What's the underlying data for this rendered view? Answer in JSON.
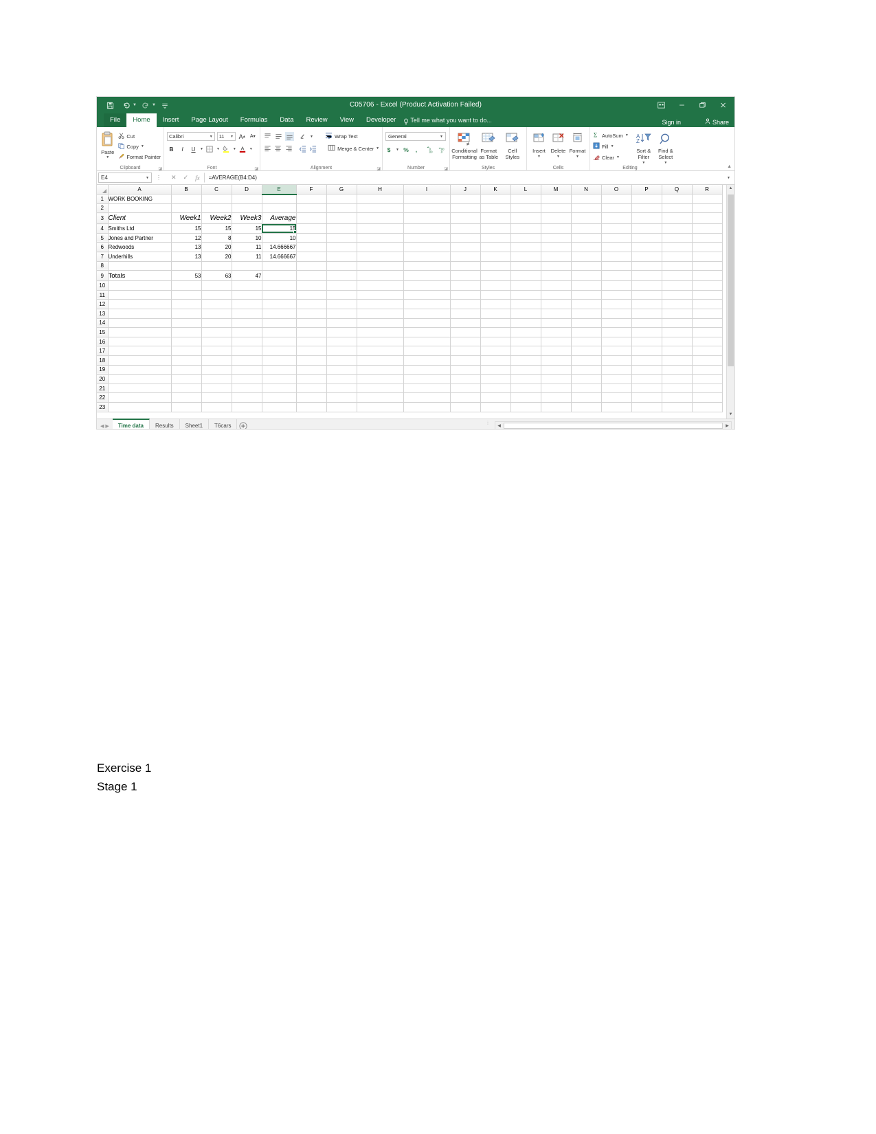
{
  "window": {
    "title": "C05706 - Excel (Product Activation Failed)",
    "quick_access": [
      {
        "name": "save-icon",
        "label": "Save"
      },
      {
        "name": "undo-icon",
        "label": "Undo"
      },
      {
        "name": "redo-icon",
        "label": "Redo"
      },
      {
        "name": "customize-qat-icon",
        "label": "Customize Quick Access Toolbar"
      }
    ],
    "controls": {
      "ribbon_display": "Ribbon Display Options",
      "minimize": "Minimize",
      "restore": "Restore Down",
      "close": "Close"
    },
    "theme_color": "#217346"
  },
  "ribbon": {
    "tabs": [
      {
        "label": "File",
        "active": false,
        "is_file": true
      },
      {
        "label": "Home",
        "active": true,
        "is_file": false
      },
      {
        "label": "Insert",
        "active": false,
        "is_file": false
      },
      {
        "label": "Page Layout",
        "active": false,
        "is_file": false
      },
      {
        "label": "Formulas",
        "active": false,
        "is_file": false
      },
      {
        "label": "Data",
        "active": false,
        "is_file": false
      },
      {
        "label": "Review",
        "active": false,
        "is_file": false
      },
      {
        "label": "View",
        "active": false,
        "is_file": false
      },
      {
        "label": "Developer",
        "active": false,
        "is_file": false
      }
    ],
    "tell_me": "Tell me what you want to do...",
    "sign_in": "Sign in",
    "share": "Share",
    "groups": {
      "clipboard": {
        "label": "Clipboard",
        "paste": "Paste",
        "cut": "Cut",
        "copy": "Copy",
        "format_painter": "Format Painter"
      },
      "font": {
        "label": "Font",
        "font_name": "Calibri",
        "font_size": "11",
        "grow": "A",
        "shrink": "A",
        "bold": "B",
        "italic": "I",
        "underline": "U"
      },
      "alignment": {
        "label": "Alignment",
        "wrap_text": "Wrap Text",
        "merge_center": "Merge & Center"
      },
      "number": {
        "label": "Number",
        "format": "General",
        "currency": "$",
        "percent": "%",
        "comma": ","
      },
      "styles": {
        "label": "Styles",
        "conditional_formatting": "Conditional Formatting",
        "format_as_table": "Format as Table",
        "cell_styles": "Cell Styles"
      },
      "cells": {
        "label": "Cells",
        "insert": "Insert",
        "delete": "Delete",
        "format": "Format"
      },
      "editing": {
        "label": "Editing",
        "autosum": "AutoSum",
        "fill": "Fill",
        "clear": "Clear",
        "sort_filter": "Sort & Filter",
        "find_select": "Find & Select"
      }
    }
  },
  "formula_bar": {
    "name_box": "E4",
    "formula": "=AVERAGE(B4:D4)",
    "cancel": "✕",
    "enter": "✓",
    "insert_function": "fx"
  },
  "sheet": {
    "columns": [
      "A",
      "B",
      "C",
      "D",
      "E",
      "F",
      "G",
      "H",
      "I",
      "J",
      "K",
      "L",
      "M",
      "N",
      "O",
      "P",
      "Q",
      "R"
    ],
    "selected_column": "E",
    "selected_cell": "E4",
    "rows": [
      1,
      2,
      3,
      4,
      5,
      6,
      7,
      8,
      9,
      10,
      11,
      12,
      13,
      14,
      15,
      16,
      17,
      18,
      19,
      20,
      21,
      22,
      23
    ],
    "cells": {
      "A1": {
        "value": "WORK BOOKING",
        "style": "b"
      },
      "A3": {
        "value": "Client",
        "style": "bi"
      },
      "B3": {
        "value": "Week1",
        "style": "bi-right"
      },
      "C3": {
        "value": "Week2",
        "style": "bi-right"
      },
      "D3": {
        "value": "Week3",
        "style": "bi-right"
      },
      "E3": {
        "value": "Average",
        "style": "bi-right"
      },
      "A4": {
        "value": "Smiths Ltd",
        "style": ""
      },
      "B4": {
        "value": "15",
        "style": "num"
      },
      "C4": {
        "value": "15",
        "style": "num"
      },
      "D4": {
        "value": "15",
        "style": "num"
      },
      "E4": {
        "value": "15",
        "style": "num-selected"
      },
      "A5": {
        "value": "Jones and Partner",
        "style": ""
      },
      "B5": {
        "value": "12",
        "style": "num"
      },
      "C5": {
        "value": "8",
        "style": "num"
      },
      "D5": {
        "value": "10",
        "style": "num"
      },
      "E5": {
        "value": "10",
        "style": "num"
      },
      "A6": {
        "value": "Redwoods",
        "style": ""
      },
      "B6": {
        "value": "13",
        "style": "num"
      },
      "C6": {
        "value": "20",
        "style": "num"
      },
      "D6": {
        "value": "11",
        "style": "num"
      },
      "E6": {
        "value": "14.666667",
        "style": "num"
      },
      "A7": {
        "value": "Underhills",
        "style": ""
      },
      "B7": {
        "value": "13",
        "style": "num"
      },
      "C7": {
        "value": "20",
        "style": "num"
      },
      "D7": {
        "value": "11",
        "style": "num"
      },
      "E7": {
        "value": "14.666667",
        "style": "num"
      },
      "A9": {
        "value": "Totals",
        "style": "b"
      },
      "B9": {
        "value": "53",
        "style": "num-b"
      },
      "C9": {
        "value": "63",
        "style": "num-b"
      },
      "D9": {
        "value": "47",
        "style": "num-b"
      }
    }
  },
  "sheet_tabs": {
    "tabs": [
      {
        "label": "Time data",
        "active": true
      },
      {
        "label": "Results",
        "active": false
      },
      {
        "label": "Sheet1",
        "active": false
      },
      {
        "label": "T6cars",
        "active": false
      }
    ],
    "add_sheet": "+",
    "nav_first": "◀",
    "nav_last": "▶"
  },
  "document": {
    "lines": [
      "Exercise 1",
      "Stage 1"
    ]
  }
}
